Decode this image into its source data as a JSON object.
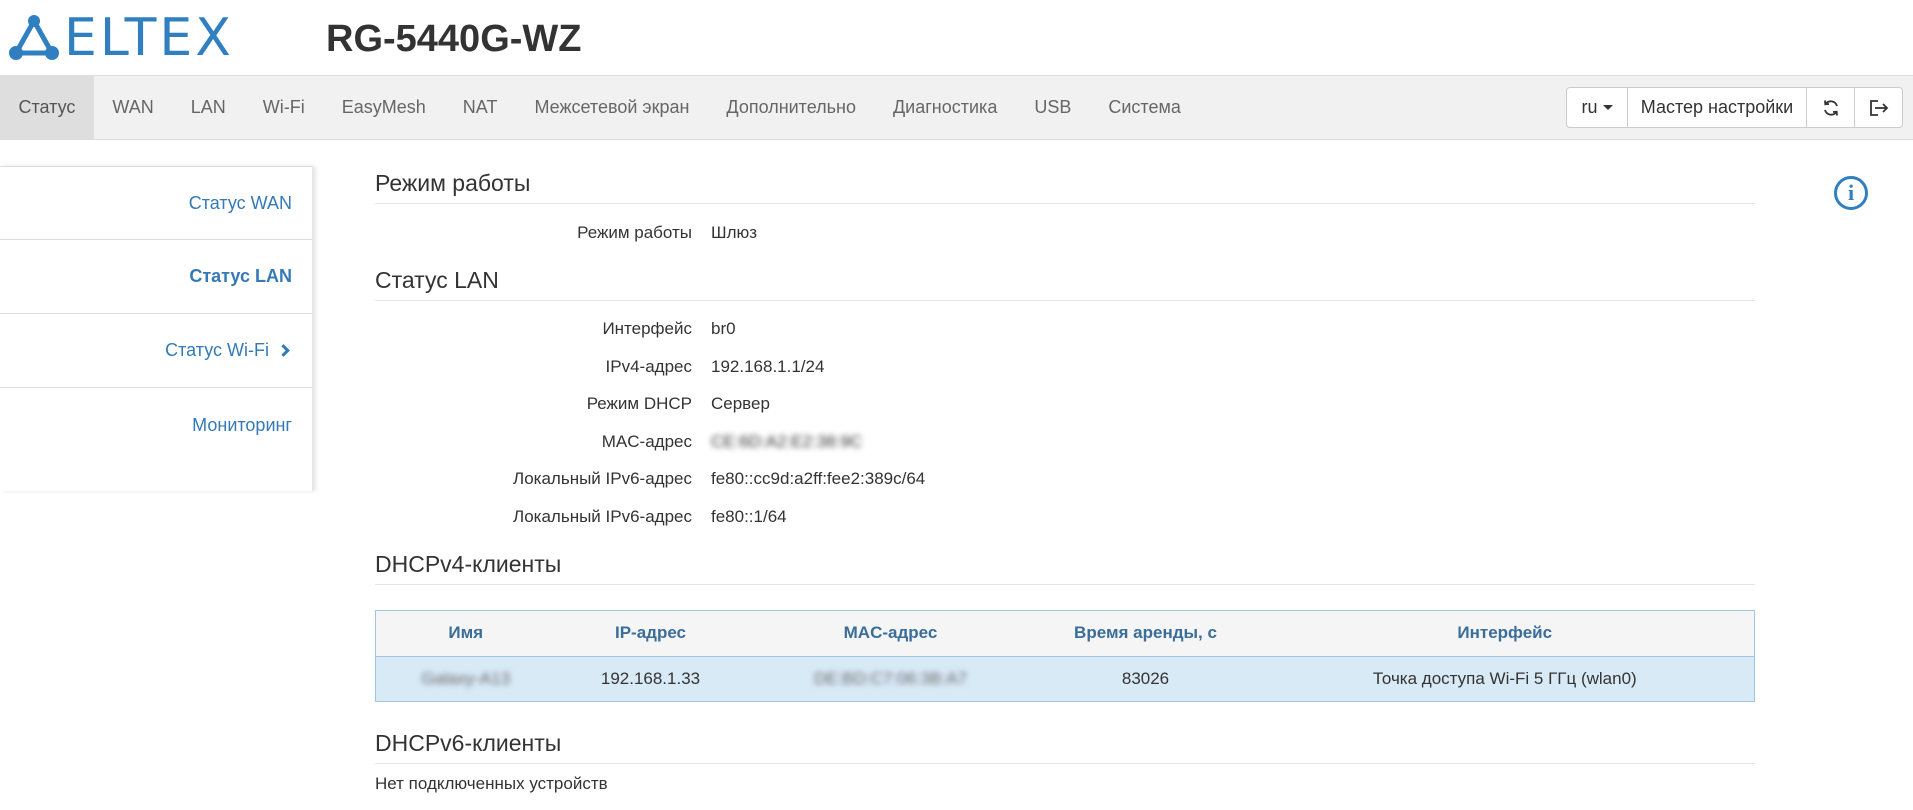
{
  "header": {
    "logo_text": "ELTEX",
    "model": "RG-5440G-WZ"
  },
  "nav": {
    "items": [
      "Статус",
      "WAN",
      "LAN",
      "Wi-Fi",
      "EasyMesh",
      "NAT",
      "Межсетевой экран",
      "Дополнительно",
      "Диагностика",
      "USB",
      "Система"
    ],
    "active": "Статус",
    "lang": "ru",
    "wizard_label": "Мастер настройки",
    "refresh_icon": "refresh-icon",
    "logout_icon": "logout-icon"
  },
  "sidebar": {
    "items": [
      {
        "label": "Статус WAN"
      },
      {
        "label": "Статус LAN"
      },
      {
        "label": "Статус Wi-Fi"
      },
      {
        "label": "Мониторинг"
      }
    ],
    "active": "Статус LAN"
  },
  "mode_section": {
    "title": "Режим работы",
    "rows": [
      {
        "key": "Режим работы",
        "value": "Шлюз"
      }
    ]
  },
  "lan_section": {
    "title": "Статус LAN",
    "rows": [
      {
        "key": "Интерфейс",
        "value": "br0"
      },
      {
        "key": "IPv4-адрес",
        "value": "192.168.1.1/24"
      },
      {
        "key": "Режим DHCP",
        "value": "Сервер"
      },
      {
        "key": "MAC-адрес",
        "value": "CE:6D:A2:E2:38:9C"
      },
      {
        "key": "Локальный IPv6-адрес",
        "value": "fe80::cc9d:a2ff:fee2:389c/64"
      },
      {
        "key": "Локальный IPv6-адрес",
        "value": "fe80::1/64"
      }
    ]
  },
  "dhcpv4": {
    "title": "DHCPv4-клиенты",
    "columns": [
      "Имя",
      "IP-адрес",
      "MAC-адрес",
      "Время аренды, с",
      "Интерфейс"
    ],
    "rows": [
      [
        "Galaxy-A13",
        "192.168.1.33",
        "DE:BD:C7:06:3B:A7",
        "83026",
        "Точка доступа Wi-Fi 5 ГГц (wlan0)"
      ]
    ]
  },
  "dhcpv6": {
    "title": "DHCPv6-клиенты",
    "empty_text": "Нет подключенных устройств"
  },
  "colors": {
    "accent": "#337ab7",
    "table_row": "#d9eaf7",
    "table_header_text": "#3a6d99"
  }
}
